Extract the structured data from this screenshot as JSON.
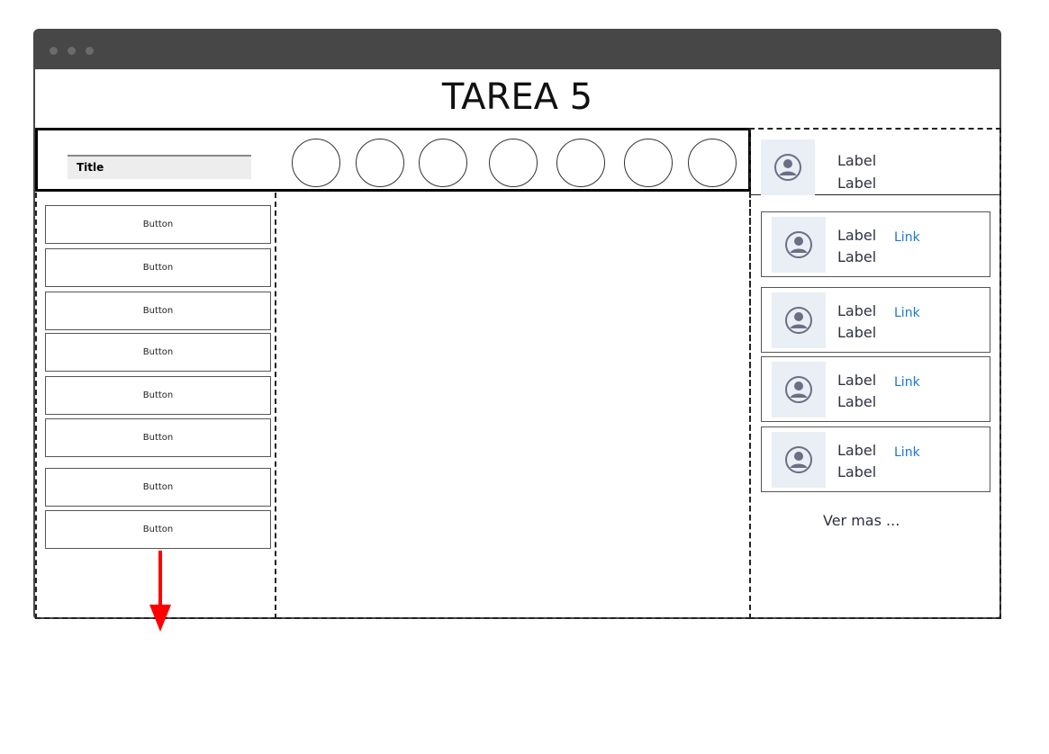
{
  "window": {
    "title": "TAREA 5"
  },
  "header": {
    "title_field": "Title"
  },
  "sidebar": {
    "buttons": [
      "Button",
      "Button",
      "Button",
      "Button",
      "Button",
      "Button",
      "Button",
      "Button"
    ]
  },
  "user_header": {
    "label1": "Label",
    "label2": "Label"
  },
  "cards": [
    {
      "label1": "Label",
      "label2": "Label",
      "link": "Link"
    },
    {
      "label1": "Label",
      "label2": "Label",
      "link": "Link"
    },
    {
      "label1": "Label",
      "label2": "Label",
      "link": "Link"
    },
    {
      "label1": "Label",
      "label2": "Label",
      "link": "Link"
    }
  ],
  "more_link": "Ver mas ...",
  "colors": {
    "accent_link": "#1976d2",
    "arrow": "#ff0000",
    "titlebar": "#474747",
    "avatar_bg": "#eaeef5"
  },
  "icons": [
    "user-avatar-icon",
    "down-arrow-icon"
  ]
}
